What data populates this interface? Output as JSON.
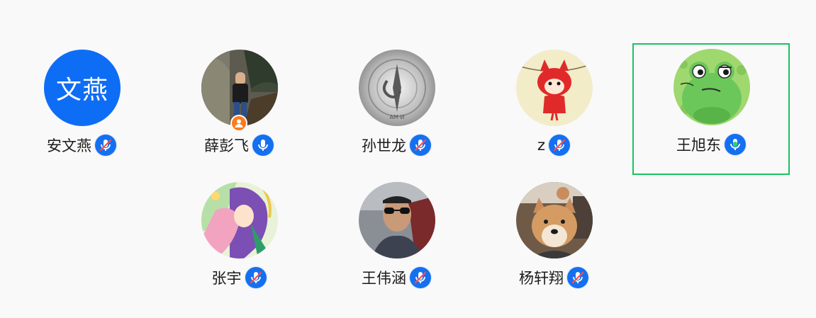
{
  "colors": {
    "background": "#f9f9fa",
    "accent_blue": "#1570f0",
    "speaking_border": "#19c35f",
    "host_badge": "#ff7a1a"
  },
  "participants": [
    {
      "name": "安文燕",
      "initials": "文燕",
      "avatar": "initials",
      "mic": "muted"
    },
    {
      "name": "薛彭飞",
      "avatar": "photo-person-forest",
      "mic": "on",
      "host": true
    },
    {
      "name": "孙世龙",
      "avatar": "photo-compass-emblem",
      "mic": "muted"
    },
    {
      "name": "z",
      "avatar": "cartoon-red-fox",
      "mic": "muted"
    },
    {
      "name": "王旭东",
      "avatar": "cartoon-green-frog",
      "mic": "speaking",
      "speaking": true
    },
    {
      "name": "张宇",
      "avatar": "anime-illustration",
      "mic": "muted"
    },
    {
      "name": "王伟涵",
      "avatar": "photo-man-sunglasses",
      "mic": "muted"
    },
    {
      "name": "杨轩翔",
      "avatar": "photo-shiba-dog",
      "mic": "muted"
    }
  ]
}
